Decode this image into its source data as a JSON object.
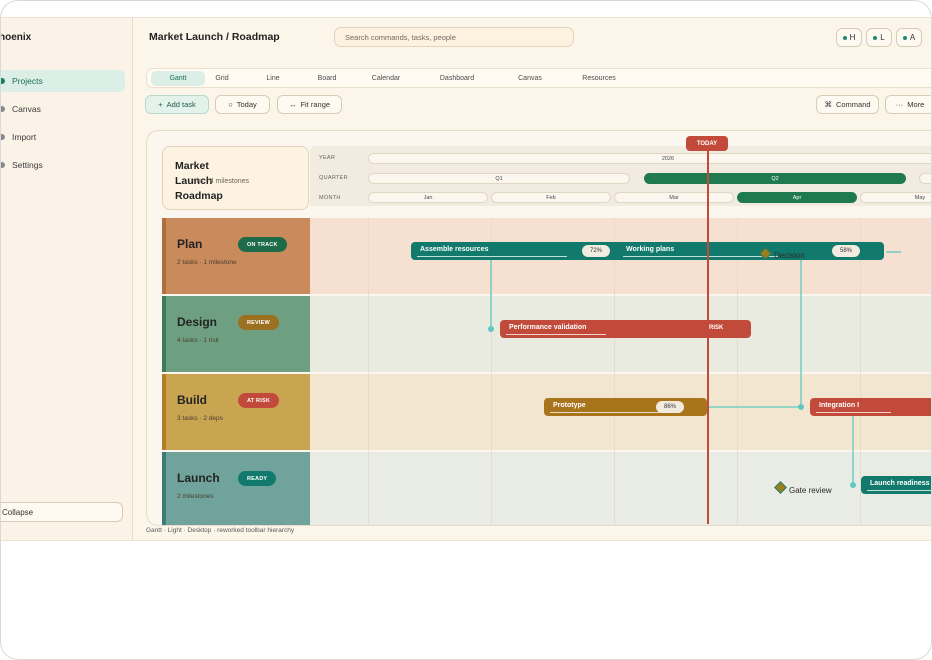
{
  "app": {
    "brand": "hoenix",
    "breadcrumb": "Market Launch / Roadmap",
    "search_placeholder": "Search commands, tasks, people",
    "avatars": [
      "H",
      "L",
      "A"
    ]
  },
  "sidebar": {
    "items": [
      {
        "label": "Projects",
        "active": true
      },
      {
        "label": "Canvas",
        "active": false
      },
      {
        "label": "Import",
        "active": false
      },
      {
        "label": "Settings",
        "active": false
      }
    ],
    "collapse_label": "Collapse"
  },
  "tabs": [
    "Gantt",
    "Grid",
    "Line",
    "Board",
    "Calendar",
    "Dashboard",
    "Canvas",
    "Resources"
  ],
  "active_tab": "Gantt",
  "toolbar": {
    "add_task": "Add task",
    "today": "Today",
    "fit_range": "Fit range",
    "command": "Command",
    "more": "More"
  },
  "roadmap": {
    "title": "Market Launch Roadmap",
    "subtitle": "sks · 4 milestones",
    "scale_labels": {
      "year": "YEAR",
      "quarter": "QUARTER",
      "month": "MONTH"
    },
    "year": "2026",
    "quarters": [
      "Q1",
      "Q2"
    ],
    "active_quarter": "Q2",
    "months": [
      "Jan",
      "Feb",
      "Mar",
      "Apr",
      "May"
    ],
    "active_month": "Apr",
    "today_label": "TODAY"
  },
  "lanes": [
    {
      "name": "Plan",
      "status": "ON TRACK",
      "meta": "2 tasks · 1 milestone",
      "color": "#c98a5c",
      "stripe": "#b06e3e",
      "badge_color": "#1e6b4a",
      "area": "#f5e0d2"
    },
    {
      "name": "Design",
      "status": "REVIEW",
      "meta": "4 tasks · 1 risk",
      "color": "#6e9f80",
      "stripe": "#3f7d5a",
      "badge_color": "#9b7020",
      "area": "#e9ebe1"
    },
    {
      "name": "Build",
      "status": "AT RISK",
      "meta": "3 tasks · 2 deps",
      "color": "#c9a451",
      "stripe": "#b07e27",
      "badge_color": "#c24a3a",
      "area": "#f3e6d0"
    },
    {
      "name": "Launch",
      "status": "READY",
      "meta": "2 milestones",
      "color": "#6fa39b",
      "stripe": "#3b7d74",
      "badge_color": "#127a6c",
      "area": "#e8ece4"
    }
  ],
  "tasks": [
    {
      "label": "Assemble resources",
      "progress": "72%",
      "color": "#127a6c"
    },
    {
      "label": "Working plans",
      "progress": "58%",
      "color": "#127a6c"
    },
    {
      "label": "Performance validation",
      "tag": "RISK",
      "color": "#c24a3a"
    },
    {
      "label": "Prototype",
      "progress": "86%",
      "color": "#a8741c"
    },
    {
      "label": "Integration I",
      "color": "#c24a3a"
    },
    {
      "label": "Launch readiness",
      "color": "#127a6c"
    }
  ],
  "milestones": [
    "Decision",
    "Gate review"
  ],
  "footer": "Gantt · Light · Desktop · reworked toolbar hierarchy"
}
